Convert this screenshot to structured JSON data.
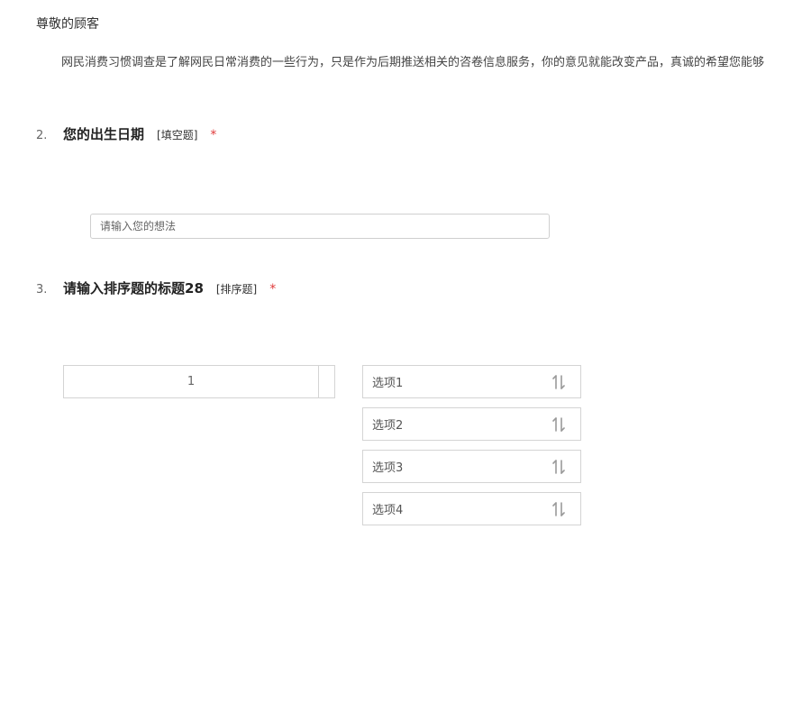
{
  "header": {
    "greeting": "尊敬的顾客",
    "intro": "网民消费习惯调查是了解网民日常消费的一些行为，只是作为后期推送相关的咨卷信息服务，你的意见就能改变产品，真诚的希望您能够"
  },
  "questions": [
    {
      "number": "2.",
      "title": "您的出生日期",
      "type": "[填空题]",
      "required": "*",
      "input_placeholder": "请输入您的想法",
      "input_value": ""
    },
    {
      "number": "3.",
      "title": "请输入排序题的标题28",
      "type": "[排序题]",
      "required": "*",
      "rank_slot": "1",
      "options": [
        {
          "label": "选项1",
          "icon": "sort-icon"
        },
        {
          "label": "选项2",
          "icon": "sort-icon"
        },
        {
          "label": "选项3",
          "icon": "sort-icon"
        },
        {
          "label": "选项4",
          "icon": "sort-icon"
        }
      ]
    }
  ],
  "colors": {
    "required": "#e03a3a",
    "border": "#d4d4d4",
    "icon": "#999999"
  }
}
